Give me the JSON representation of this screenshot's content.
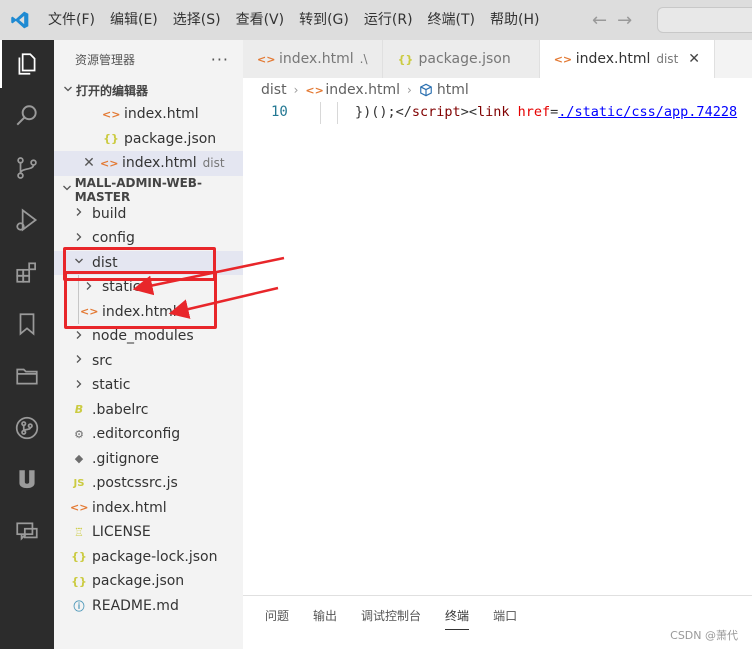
{
  "menu": [
    "文件(F)",
    "编辑(E)",
    "选择(S)",
    "查看(V)",
    "转到(G)",
    "运行(R)",
    "终端(T)",
    "帮助(H)"
  ],
  "nav": {
    "back": "←",
    "forward": "→"
  },
  "activity_bar": [
    "explorer-icon",
    "search-icon",
    "source-control-icon",
    "run-debug-icon",
    "extensions-icon",
    "bookmarks-icon",
    "folder-icon",
    "git-graph-icon",
    "u-icon",
    "remote-chat-icon"
  ],
  "sidebar": {
    "title": "资源管理器",
    "more": "···",
    "open_editors": {
      "header": "打开的编辑器",
      "items": [
        {
          "name": "index.html",
          "hint": ""
        },
        {
          "name": "package.json",
          "hint": ""
        },
        {
          "name": "index.html",
          "hint": "dist"
        }
      ]
    },
    "project": {
      "header": "MALL-ADMIN-WEB-MASTER",
      "items": [
        {
          "name": "build",
          "kind": "folder"
        },
        {
          "name": "config",
          "kind": "folder"
        },
        {
          "name": "dist",
          "kind": "folder-open"
        },
        {
          "name": "static",
          "kind": "folder"
        },
        {
          "name": "index.html",
          "kind": "html"
        },
        {
          "name": "node_modules",
          "kind": "folder"
        },
        {
          "name": "src",
          "kind": "folder"
        },
        {
          "name": "static",
          "kind": "folder"
        },
        {
          "name": ".babelrc",
          "kind": "babel"
        },
        {
          "name": ".editorconfig",
          "kind": "gear"
        },
        {
          "name": ".gitignore",
          "kind": "git"
        },
        {
          "name": ".postcssrc.js",
          "kind": "js"
        },
        {
          "name": "index.html",
          "kind": "html"
        },
        {
          "name": "LICENSE",
          "kind": "license"
        },
        {
          "name": "package-lock.json",
          "kind": "json"
        },
        {
          "name": "package.json",
          "kind": "json"
        },
        {
          "name": "README.md",
          "kind": "info"
        }
      ]
    }
  },
  "tabs": [
    {
      "name": "index.html",
      "hint": ".\\"
    },
    {
      "name": "package.json",
      "hint": ""
    },
    {
      "name": "index.html",
      "hint": "dist"
    }
  ],
  "tab_close": "✕",
  "breadcrumb": {
    "folder": "dist",
    "file": "index.html",
    "element": "html"
  },
  "editor": {
    "line_number": "10",
    "code": {
      "part1": "})();</",
      "part2": "script",
      "part3": "><",
      "part4": "link",
      "part5": " ",
      "part6": "href",
      "part7": "=",
      "part8": "./static/css/app.74228"
    }
  },
  "panel_tabs": [
    "问题",
    "输出",
    "调试控制台",
    "终端",
    "端口"
  ],
  "watermark": "CSDN @萧代",
  "colors": {
    "annotation": "#e8262a",
    "accent": "#007acc"
  }
}
